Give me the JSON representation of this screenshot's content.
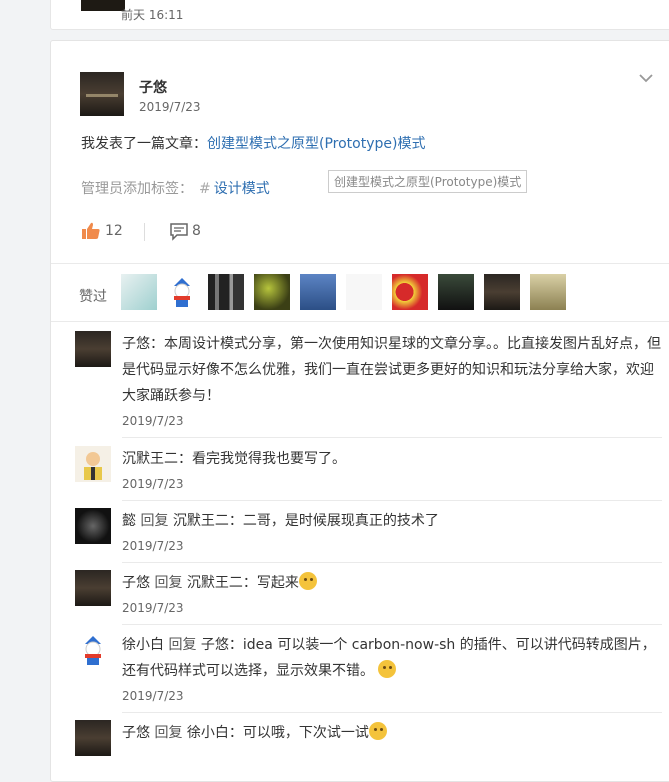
{
  "previous_post": {
    "time": "前天 16:11"
  },
  "post": {
    "author": "子悠",
    "date": "2019/7/23",
    "text_prefix": "我发表了一篇文章：",
    "link_text": "创建型模式之原型(Prototype)模式",
    "tag_label": "管理员添加标签：",
    "tag_hash": "#",
    "tag": "设计模式",
    "tooltip": "创建型模式之原型(Prototype)模式",
    "like_count": "12",
    "comment_count": "8",
    "likes_label": "赞过"
  },
  "colors": {
    "link": "#2f6fb1",
    "like": "#f08a4b"
  },
  "comments": [
    {
      "author": "子悠",
      "reply_to": "",
      "text": "本周设计模式分享，第一次使用知识星球的文章分享。。比直接发图片乱好点，但是代码显示好像不怎么优雅，我们一直在尝试更多更好的知识和玩法分享给大家，欢迎大家踊跃参与！",
      "date": "2019/7/23"
    },
    {
      "author": "沉默王二",
      "reply_to": "",
      "text": "看完我觉得我也要写了。",
      "date": "2019/7/23"
    },
    {
      "author": "懿",
      "reply_word": "回复",
      "reply_to": "沉默王二",
      "text": "二哥，是时候展现真正的技术了",
      "date": "2019/7/23"
    },
    {
      "author": "子悠",
      "reply_word": "回复",
      "reply_to": "沉默王二",
      "text": "写起来",
      "date": "2019/7/23"
    },
    {
      "author": "徐小白",
      "reply_word": "回复",
      "reply_to": "子悠",
      "text": "idea 可以装一个 carbon-now-sh 的插件、可以讲代码转成图片，还有代码样式可以选择，显示效果不错。",
      "date": "2019/7/23"
    },
    {
      "author": "子悠",
      "reply_word": "回复",
      "reply_to": "徐小白",
      "text": "可以哦，下次试一试",
      "date": ""
    }
  ],
  "colon": "："
}
